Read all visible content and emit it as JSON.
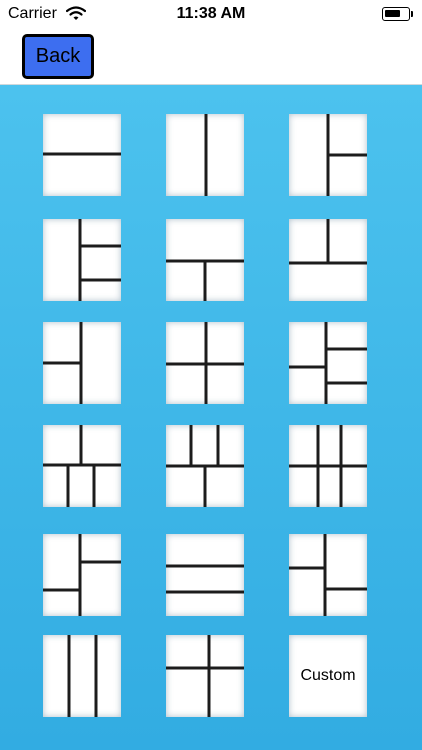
{
  "status_bar": {
    "carrier": "Carrier",
    "time": "11:38 AM"
  },
  "nav": {
    "back_label": "Back"
  },
  "grid": {
    "custom_label": "Custom"
  }
}
